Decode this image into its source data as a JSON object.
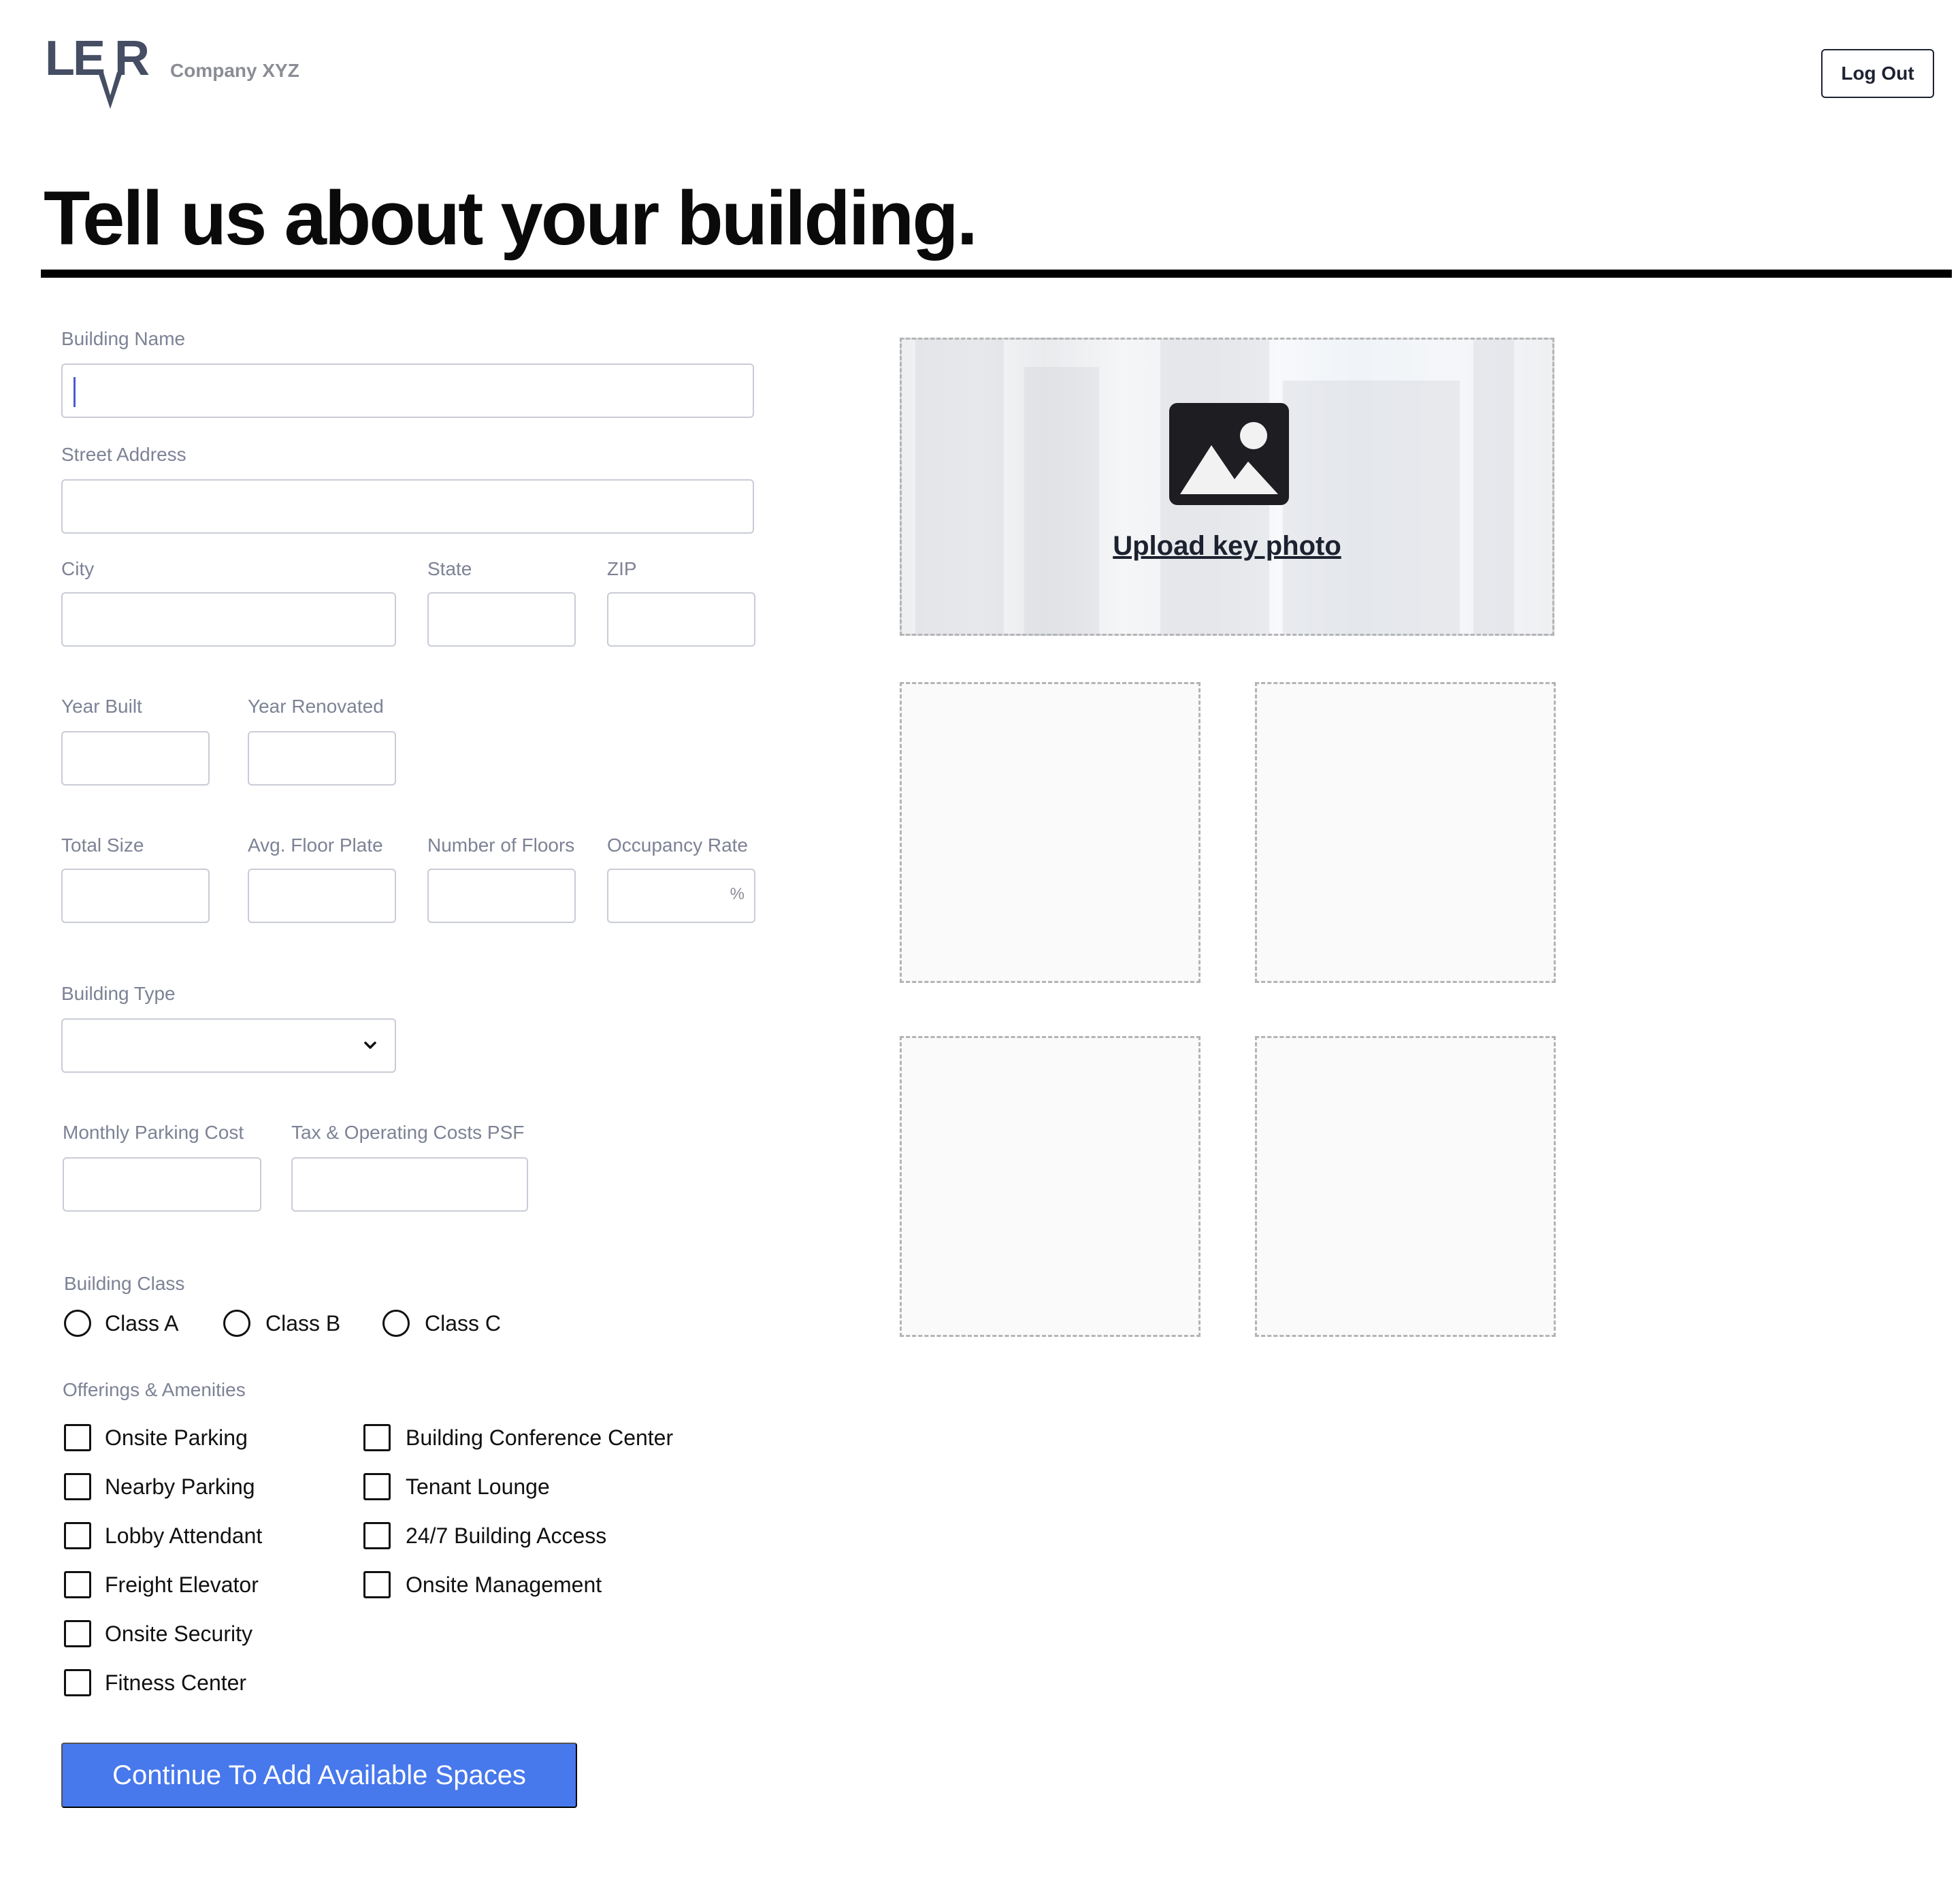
{
  "header": {
    "logo_text": "LEVR",
    "company": "Company XYZ",
    "logout_label": "Log Out"
  },
  "page_title": "Tell us about your building.",
  "form": {
    "building_name": {
      "label": "Building Name",
      "value": ""
    },
    "street_address": {
      "label": "Street Address",
      "value": ""
    },
    "city": {
      "label": "City",
      "value": ""
    },
    "state": {
      "label": "State",
      "value": ""
    },
    "zip": {
      "label": "ZIP",
      "value": ""
    },
    "year_built": {
      "label": "Year Built",
      "value": ""
    },
    "year_renovated": {
      "label": "Year Renovated",
      "value": ""
    },
    "total_size": {
      "label": "Total Size",
      "value": ""
    },
    "avg_floor_plate": {
      "label": "Avg. Floor Plate",
      "value": ""
    },
    "number_of_floors": {
      "label": "Number of Floors",
      "value": ""
    },
    "occupancy_rate": {
      "label": "Occupancy Rate",
      "value": "",
      "suffix": "%"
    },
    "building_type": {
      "label": "Building Type",
      "selected": ""
    },
    "monthly_parking_cost": {
      "label": "Monthly Parking Cost",
      "value": ""
    },
    "tax_operating_costs": {
      "label": "Tax & Operating Costs PSF",
      "value": ""
    },
    "building_class": {
      "label": "Building Class",
      "options": [
        "Class A",
        "Class B",
        "Class C"
      ],
      "selected": null
    },
    "amenities": {
      "label": "Offerings & Amenities",
      "column1": [
        "Onsite Parking",
        "Nearby Parking",
        "Lobby Attendant",
        "Freight Elevator",
        "Onsite Security",
        "Fitness Center"
      ],
      "column2": [
        "Building Conference Center",
        "Tenant Lounge",
        "24/7 Building Access",
        "Onsite Management"
      ]
    },
    "submit_label": "Continue To Add Available Spaces"
  },
  "photos": {
    "upload_label": "Upload key photo",
    "upload_icon": "image-icon",
    "extra_slots": 4
  },
  "colors": {
    "accent": "#4778ec",
    "text_dark": "#1d2230",
    "label_gray": "#7d8295",
    "border_gray": "#c9ccd6",
    "logo_slate": "#454e63"
  }
}
